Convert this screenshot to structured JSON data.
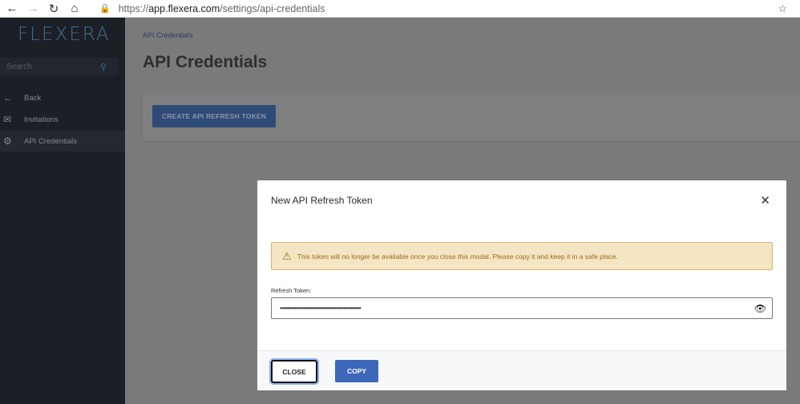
{
  "browser": {
    "url_prefix": "https://",
    "url_host": "app.flexera.com",
    "url_path": "/settings/api-credentials",
    "icons": [
      "back-arrow",
      "forward-arrow",
      "reload",
      "home",
      "lock",
      "favorite-star"
    ]
  },
  "sidebar": {
    "logo": "FLEXERA",
    "search_placeholder": "Search",
    "items": [
      {
        "label": "Back",
        "icon": "arrow-left-icon",
        "active": false
      },
      {
        "label": "Invitations",
        "icon": "envelope-icon",
        "active": false
      },
      {
        "label": "API Credentials",
        "icon": "gear-icon",
        "active": true
      }
    ]
  },
  "main": {
    "breadcrumb": "API Credentials",
    "title": "API Credentials",
    "create_button": "CREATE API REFRESH TOKEN"
  },
  "modal": {
    "title": "New API Refresh Token",
    "alert_text": "This token will no longer be available once you close this modal. Please copy it and keep it in a safe place.",
    "field_label": "Refresh Token:",
    "token_value": "••••••••••••••••••••••••••••••••••••••••••••••••••••••••",
    "close_button": "CLOSE",
    "copy_button": "COPY"
  },
  "colors": {
    "sidebar_bg": "#1d1f27",
    "accent": "#3d67b8",
    "alert_bg": "#f4e5c3",
    "alert_text": "#9c6a1e"
  }
}
